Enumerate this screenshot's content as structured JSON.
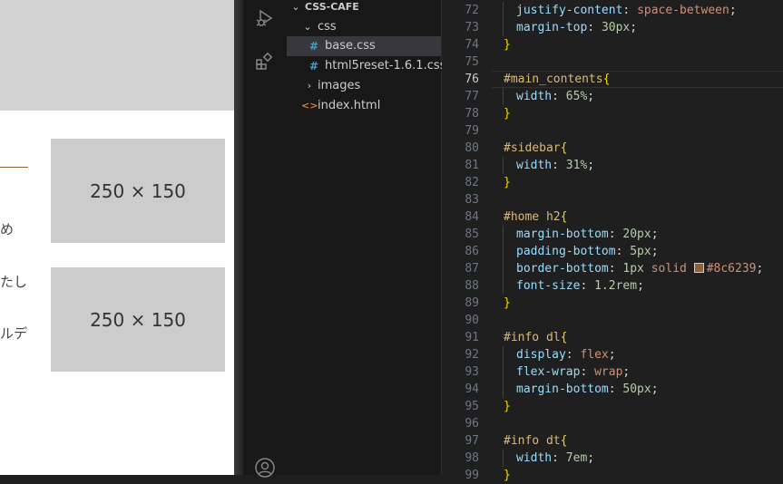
{
  "preview": {
    "placeholder1": "250 × 150",
    "placeholder2": "250 × 150",
    "text_fragment_1": "め",
    "text_fragment_2": "たし",
    "text_fragment_3": "ルデ",
    "rule_color": "#8c6239"
  },
  "activity_bar": {
    "icons": [
      "run-debug-icon",
      "extensions-icon",
      "account-icon"
    ]
  },
  "explorer": {
    "project": "CSS-CAFE",
    "folder_css": "css",
    "file_base": "base.css",
    "file_reset": "html5reset-1.6.1.css",
    "folder_images": "images",
    "file_index": "index.html",
    "css_icon": "#",
    "html_icon": "<>"
  },
  "editor": {
    "lines": [
      {
        "n": "72",
        "tokens": [
          [
            "prop",
            "justify-content"
          ],
          [
            "punc",
            ": "
          ],
          [
            "val",
            "space-between"
          ],
          [
            "punc",
            ";"
          ]
        ],
        "indent": true
      },
      {
        "n": "73",
        "tokens": [
          [
            "prop",
            "margin-top"
          ],
          [
            "punc",
            ": "
          ],
          [
            "num",
            "30px"
          ],
          [
            "punc",
            ";"
          ]
        ],
        "indent": true
      },
      {
        "n": "74",
        "tokens": [
          [
            "brace",
            "}"
          ]
        ]
      },
      {
        "n": "75",
        "tokens": []
      },
      {
        "n": "76",
        "tokens": [
          [
            "sel",
            "#main_contents"
          ],
          [
            "brace",
            "{"
          ]
        ]
      },
      {
        "n": "77",
        "tokens": [
          [
            "prop",
            "width"
          ],
          [
            "punc",
            ": "
          ],
          [
            "num",
            "65%"
          ],
          [
            "punc",
            ";"
          ]
        ],
        "indent": true
      },
      {
        "n": "78",
        "tokens": [
          [
            "brace",
            "}"
          ]
        ]
      },
      {
        "n": "79",
        "tokens": []
      },
      {
        "n": "80",
        "tokens": [
          [
            "sel",
            "#sidebar"
          ],
          [
            "brace",
            "{"
          ]
        ]
      },
      {
        "n": "81",
        "tokens": [
          [
            "prop",
            "width"
          ],
          [
            "punc",
            ": "
          ],
          [
            "num",
            "31%"
          ],
          [
            "punc",
            ";"
          ]
        ],
        "indent": true
      },
      {
        "n": "82",
        "tokens": [
          [
            "brace",
            "}"
          ]
        ]
      },
      {
        "n": "83",
        "tokens": []
      },
      {
        "n": "84",
        "tokens": [
          [
            "sel",
            "#home h2"
          ],
          [
            "brace",
            "{"
          ]
        ]
      },
      {
        "n": "85",
        "tokens": [
          [
            "prop",
            "margin-bottom"
          ],
          [
            "punc",
            ": "
          ],
          [
            "num",
            "20px"
          ],
          [
            "punc",
            ";"
          ]
        ],
        "indent": true
      },
      {
        "n": "86",
        "tokens": [
          [
            "prop",
            "padding-bottom"
          ],
          [
            "punc",
            ": "
          ],
          [
            "num",
            "5px"
          ],
          [
            "punc",
            ";"
          ]
        ],
        "indent": true
      },
      {
        "n": "87",
        "tokens": [
          [
            "prop",
            "border-bottom"
          ],
          [
            "punc",
            ": "
          ],
          [
            "num",
            "1px"
          ],
          [
            "punc",
            " "
          ],
          [
            "val",
            "solid"
          ],
          [
            "punc",
            " "
          ],
          [
            "swatch",
            ""
          ],
          [
            "val",
            "#8c6239"
          ],
          [
            "punc",
            ";"
          ]
        ],
        "indent": true
      },
      {
        "n": "88",
        "tokens": [
          [
            "prop",
            "font-size"
          ],
          [
            "punc",
            ": "
          ],
          [
            "num",
            "1.2rem"
          ],
          [
            "punc",
            ";"
          ]
        ],
        "indent": true
      },
      {
        "n": "89",
        "tokens": [
          [
            "brace",
            "}"
          ]
        ]
      },
      {
        "n": "90",
        "tokens": []
      },
      {
        "n": "91",
        "tokens": [
          [
            "sel",
            "#info dl"
          ],
          [
            "brace",
            "{"
          ]
        ]
      },
      {
        "n": "92",
        "tokens": [
          [
            "prop",
            "display"
          ],
          [
            "punc",
            ": "
          ],
          [
            "val",
            "flex"
          ],
          [
            "punc",
            ";"
          ]
        ],
        "indent": true
      },
      {
        "n": "93",
        "tokens": [
          [
            "prop",
            "flex-wrap"
          ],
          [
            "punc",
            ": "
          ],
          [
            "val",
            "wrap"
          ],
          [
            "punc",
            ";"
          ]
        ],
        "indent": true
      },
      {
        "n": "94",
        "tokens": [
          [
            "prop",
            "margin-bottom"
          ],
          [
            "punc",
            ": "
          ],
          [
            "num",
            "50px"
          ],
          [
            "punc",
            ";"
          ]
        ],
        "indent": true
      },
      {
        "n": "95",
        "tokens": [
          [
            "brace",
            "}"
          ]
        ]
      },
      {
        "n": "96",
        "tokens": []
      },
      {
        "n": "97",
        "tokens": [
          [
            "sel",
            "#info dt"
          ],
          [
            "brace",
            "{"
          ]
        ]
      },
      {
        "n": "98",
        "tokens": [
          [
            "prop",
            "width"
          ],
          [
            "punc",
            ": "
          ],
          [
            "num",
            "7em"
          ],
          [
            "punc",
            ";"
          ]
        ],
        "indent": true
      },
      {
        "n": "99",
        "tokens": [
          [
            "brace",
            "}"
          ]
        ]
      }
    ],
    "current_line": "76"
  }
}
